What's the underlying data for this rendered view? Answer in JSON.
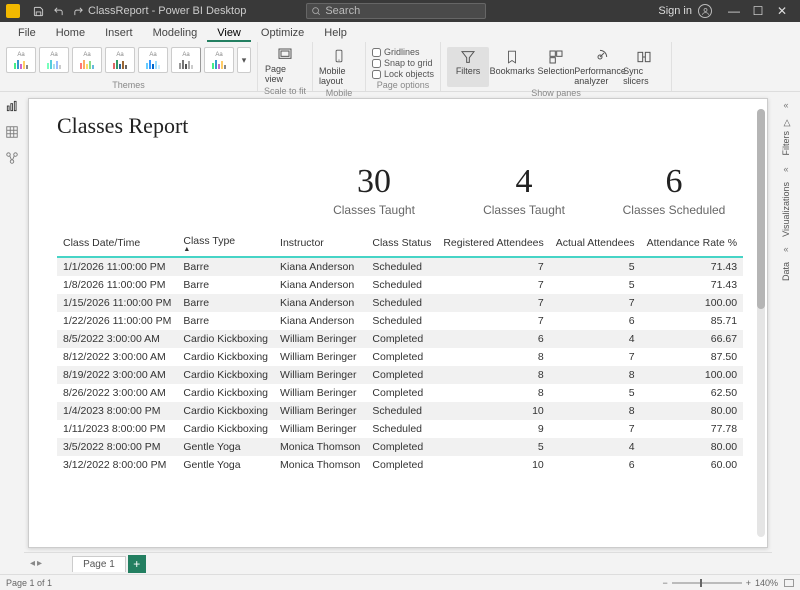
{
  "titlebar": {
    "app_name": "ClassReport - Power BI Desktop",
    "search_placeholder": "Search",
    "signin": "Sign in"
  },
  "menu": {
    "file": "File",
    "home": "Home",
    "insert": "Insert",
    "modeling": "Modeling",
    "view": "View",
    "optimize": "Optimize",
    "help": "Help"
  },
  "ribbon": {
    "themes": "Themes",
    "page_view": "Page view",
    "scale_to_fit": "Scale to fit",
    "mobile_layout": "Mobile layout",
    "mobile": "Mobile",
    "gridlines": "Gridlines",
    "snap": "Snap to grid",
    "lock": "Lock objects",
    "page_options": "Page options",
    "filters": "Filters",
    "bookmarks": "Bookmarks",
    "selection": "Selection",
    "perf": "Performance analyzer",
    "sync": "Sync slicers",
    "show_panes": "Show panes"
  },
  "right_panes": {
    "filters": "Filters",
    "viz": "Visualizations",
    "data": "Data"
  },
  "report": {
    "title": "Classes Report",
    "kpis": [
      {
        "value": "30",
        "label": "Classes Taught"
      },
      {
        "value": "4",
        "label": "Classes Taught"
      },
      {
        "value": "6",
        "label": "Classes Scheduled"
      }
    ],
    "columns": [
      "Class Date/Time",
      "Class Type",
      "Instructor",
      "Class Status",
      "Registered Attendees",
      "Actual Attendees",
      "Attendance Rate %"
    ],
    "rows": [
      [
        "1/1/2026 11:00:00 PM",
        "Barre",
        "Kiana Anderson",
        "Scheduled",
        "7",
        "5",
        "71.43"
      ],
      [
        "1/8/2026 11:00:00 PM",
        "Barre",
        "Kiana Anderson",
        "Scheduled",
        "7",
        "5",
        "71.43"
      ],
      [
        "1/15/2026 11:00:00 PM",
        "Barre",
        "Kiana Anderson",
        "Scheduled",
        "7",
        "7",
        "100.00"
      ],
      [
        "1/22/2026 11:00:00 PM",
        "Barre",
        "Kiana Anderson",
        "Scheduled",
        "7",
        "6",
        "85.71"
      ],
      [
        "8/5/2022 3:00:00 AM",
        "Cardio Kickboxing",
        "William Beringer",
        "Completed",
        "6",
        "4",
        "66.67"
      ],
      [
        "8/12/2022 3:00:00 AM",
        "Cardio Kickboxing",
        "William Beringer",
        "Completed",
        "8",
        "7",
        "87.50"
      ],
      [
        "8/19/2022 3:00:00 AM",
        "Cardio Kickboxing",
        "William Beringer",
        "Completed",
        "8",
        "8",
        "100.00"
      ],
      [
        "8/26/2022 3:00:00 AM",
        "Cardio Kickboxing",
        "William Beringer",
        "Completed",
        "8",
        "5",
        "62.50"
      ],
      [
        "1/4/2023 8:00:00 PM",
        "Cardio Kickboxing",
        "William Beringer",
        "Scheduled",
        "10",
        "8",
        "80.00"
      ],
      [
        "1/11/2023 8:00:00 PM",
        "Cardio Kickboxing",
        "William Beringer",
        "Scheduled",
        "9",
        "7",
        "77.78"
      ],
      [
        "3/5/2022 8:00:00 PM",
        "Gentle Yoga",
        "Monica Thomson",
        "Completed",
        "5",
        "4",
        "80.00"
      ],
      [
        "3/12/2022 8:00:00 PM",
        "Gentle Yoga",
        "Monica Thomson",
        "Completed",
        "10",
        "6",
        "60.00"
      ]
    ]
  },
  "pagebar": {
    "tab": "Page 1"
  },
  "status": {
    "page": "Page 1 of 1",
    "zoom": "140%"
  }
}
